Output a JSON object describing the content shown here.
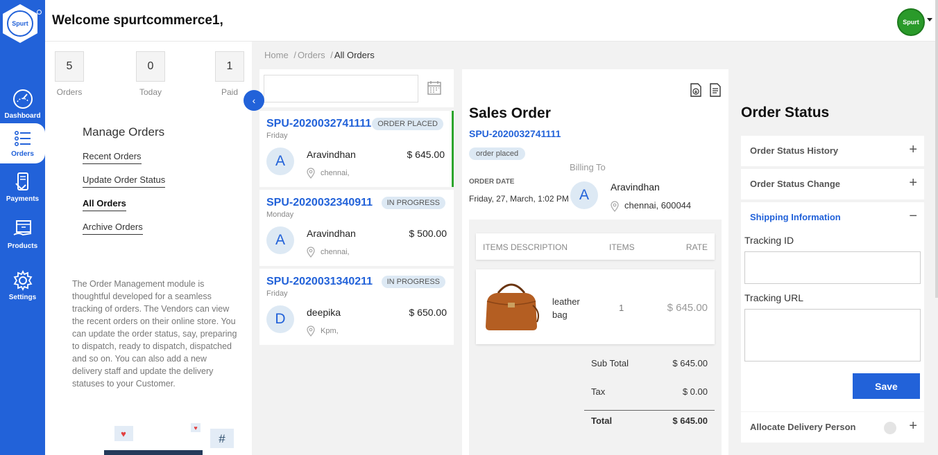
{
  "header": {
    "welcome": "Welcome spurtcommerce1,",
    "avatar_text": "Spurt"
  },
  "logo": {
    "text": "Spurt"
  },
  "nav": [
    {
      "label": "Dashboard",
      "icon": "dashboard-gauge-icon"
    },
    {
      "label": "Orders",
      "icon": "orders-list-icon"
    },
    {
      "label": "Payments",
      "icon": "payments-card-icon"
    },
    {
      "label": "Products",
      "icon": "products-box-icon"
    },
    {
      "label": "Settings",
      "icon": "settings-gear-icon"
    }
  ],
  "stats": [
    {
      "value": "5",
      "label": "Orders"
    },
    {
      "value": "0",
      "label": "Today"
    },
    {
      "value": "1",
      "label": "Paid"
    }
  ],
  "manage": {
    "title": "Manage Orders",
    "links": [
      "Recent Orders",
      "Update Order Status",
      "All Orders",
      "Archive Orders"
    ],
    "active_link": "All Orders",
    "description": "The Order Management module is thoughtful developed for a seamless tracking of orders. The Vendors can view the recent orders on their online store. You can update the order status, say, preparing to dispatch, ready to dispatch, dispatched and so on. You can also add a new delivery staff and update the delivery statuses to your Customer."
  },
  "breadcrumb": {
    "home": "Home",
    "sep1": "/",
    "orders": "Orders",
    "sep2": "/",
    "current": "All Orders"
  },
  "orders": [
    {
      "id": "SPU-2020032741111",
      "day": "Friday",
      "status": "ORDER PLACED",
      "initial": "A",
      "name": "Aravindhan",
      "amount": "$ 645.00",
      "location": "chennai,"
    },
    {
      "id": "SPU-2020032340911",
      "day": "Monday",
      "status": "IN PROGRESS",
      "initial": "A",
      "name": "Aravindhan",
      "amount": "$ 500.00",
      "location": "chennai,"
    },
    {
      "id": "SPU-2020031340211",
      "day": "Friday",
      "status": "IN PROGRESS",
      "initial": "D",
      "name": "deepika",
      "amount": "$ 650.00",
      "location": "Kpm,"
    }
  ],
  "sales_order": {
    "title": "Sales Order",
    "id": "SPU-2020032741111",
    "status": "order placed",
    "billing_to_label": "Billing To",
    "order_date_label": "ORDER DATE",
    "order_date": "Friday, 27, March, 1:02 PM",
    "bill_initial": "A",
    "bill_name": "Aravindhan",
    "bill_location": "chennai, 600044",
    "columns": {
      "desc": "ITEMS DESCRIPTION",
      "items": "ITEMS",
      "rate": "RATE"
    },
    "item": {
      "name": "leather bag",
      "qty": "1",
      "rate": "$ 645.00"
    },
    "subtotal_label": "Sub Total",
    "subtotal": "$ 645.00",
    "tax_label": "Tax",
    "tax": "$ 0.00",
    "total_label": "Total",
    "total": "$ 645.00"
  },
  "order_status": {
    "title": "Order Status",
    "sections": [
      "Order Status History",
      "Order Status Change",
      "Shipping Information",
      "Allocate Delivery Person"
    ],
    "plus": "+",
    "minus": "−",
    "tracking_id_label": "Tracking ID",
    "tracking_url_label": "Tracking URL",
    "tracking_id_value": "",
    "tracking_url_value": "",
    "save": "Save"
  },
  "colors": {
    "primary": "#2262d9",
    "active_border": "#2ca52c",
    "badge_bg": "#dde9f4"
  }
}
